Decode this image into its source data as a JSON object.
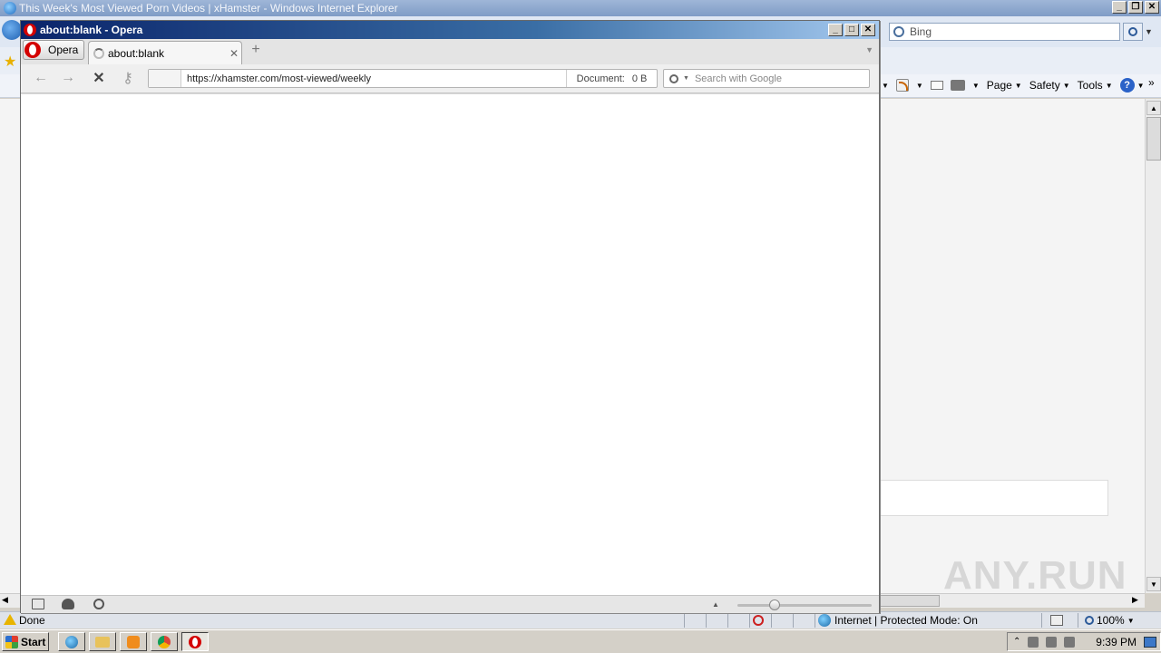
{
  "ie": {
    "title": "This Week's Most Viewed Porn Videos | xHamster - Windows Internet Explorer",
    "search_placeholder": "Bing",
    "commands": {
      "page": "Page",
      "safety": "Safety",
      "tools": "Tools"
    },
    "status": {
      "text": "Done",
      "zone": "Internet | Protected Mode: On",
      "zoom": "100%"
    }
  },
  "opera": {
    "window_title": "about:blank - Opera",
    "menu_label": "Opera",
    "tab_title": "about:blank",
    "address_url": "https://xhamster.com/most-viewed/weekly",
    "document_label": "Document:",
    "document_size": "0 B",
    "search_placeholder": "Search with Google"
  },
  "watermark": "ANY.RUN",
  "taskbar": {
    "start_label": "Start",
    "clock": "9:39 PM"
  }
}
